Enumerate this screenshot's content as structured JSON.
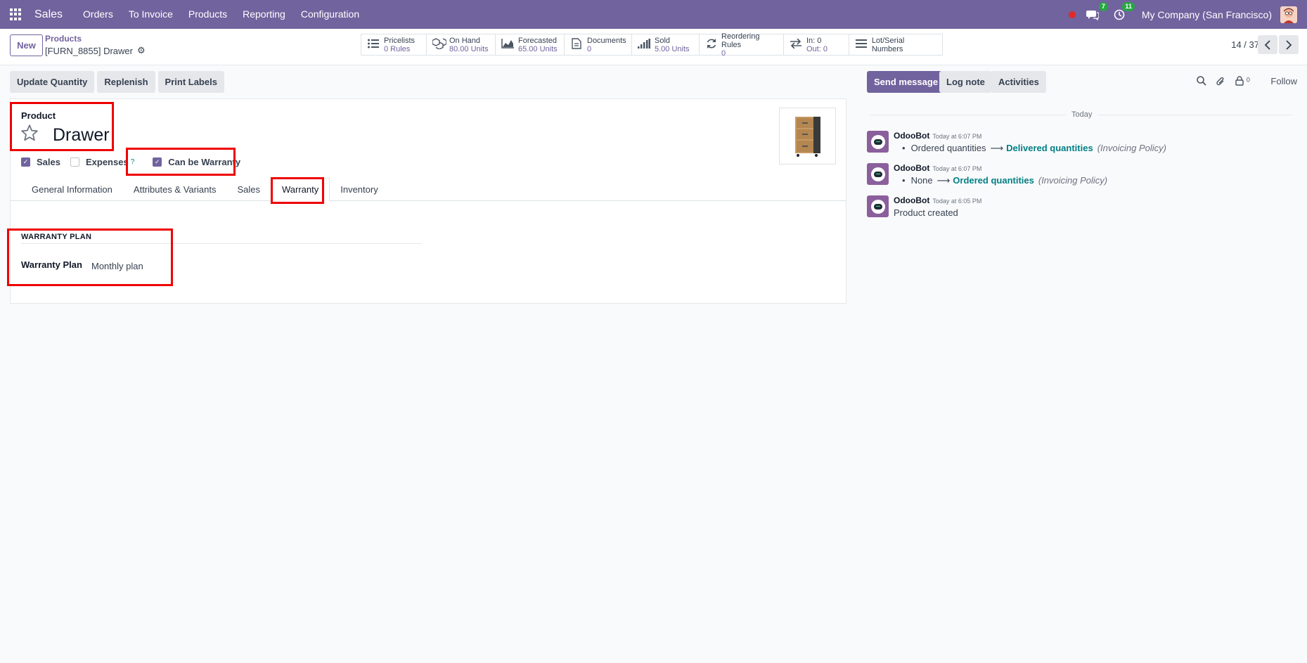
{
  "navbar": {
    "app_name": "Sales",
    "menu": [
      "Orders",
      "To Invoice",
      "Products",
      "Reporting",
      "Configuration"
    ],
    "messages_badge": "7",
    "activities_badge": "11",
    "company": "My Company (San Francisco)"
  },
  "control_panel": {
    "new_label": "New",
    "breadcrumb": "Products",
    "record_name": "[FURN_8855] Drawer",
    "pager": "14 / 37"
  },
  "smart_buttons": [
    {
      "name": "pricelists",
      "icon": "list-icon",
      "label": "Pricelists",
      "value": "0 Rules"
    },
    {
      "name": "on-hand",
      "icon": "cubes-icon",
      "label": "On Hand",
      "value": "80.00 Units"
    },
    {
      "name": "forecasted",
      "icon": "area-chart-icon",
      "label": "Forecasted",
      "value": "65.00 Units"
    },
    {
      "name": "documents",
      "icon": "file-icon",
      "label": "Documents",
      "value": "0"
    },
    {
      "name": "sold",
      "icon": "signal-icon",
      "label": "Sold",
      "value": "5.00 Units"
    },
    {
      "name": "reordering-rules",
      "icon": "refresh-icon",
      "label": "Reordering Rules",
      "value": "0"
    },
    {
      "name": "in-out",
      "icon": "exchange-icon",
      "label": "In: 0",
      "value": "Out: 0"
    },
    {
      "name": "lot-serial",
      "icon": "bars-icon",
      "label": "Lot/Serial Numbers",
      "value": ""
    }
  ],
  "actions": {
    "update_quantity": "Update Quantity",
    "replenish": "Replenish",
    "print_labels": "Print Labels"
  },
  "form": {
    "product_label": "Product",
    "product_name": "Drawer",
    "checkboxes": {
      "sales": {
        "label": "Sales",
        "checked": true
      },
      "expenses": {
        "label": "Expenses",
        "checked": false,
        "help": "?"
      },
      "warranty": {
        "label": "Can be Warranty",
        "checked": true
      }
    },
    "tabs": [
      "General Information",
      "Attributes & Variants",
      "Sales",
      "Warranty",
      "Inventory"
    ],
    "active_tab": "Warranty",
    "section_title": "WARRANTY PLAN",
    "warranty_plan_label": "Warranty Plan",
    "warranty_plan_value": "Monthly plan"
  },
  "chatter": {
    "send_message": "Send message",
    "log_note": "Log note",
    "activities": "Activities",
    "follower_count": "0",
    "follow": "Follow",
    "date_separator": "Today",
    "messages": [
      {
        "author": "OdooBot",
        "time": "Today at 6:07 PM",
        "old": "Ordered quantities",
        "new": "Delivered quantities",
        "field": "(Invoicing Policy)"
      },
      {
        "author": "OdooBot",
        "time": "Today at 6:07 PM",
        "old": "None",
        "new": "Ordered quantities",
        "field": "(Invoicing Policy)"
      },
      {
        "author": "OdooBot",
        "time": "Today at 6:05 PM",
        "text": "Product created"
      }
    ]
  },
  "colors": {
    "brand": "#71639e",
    "link": "#017e84",
    "highlight": "#ee0000"
  }
}
